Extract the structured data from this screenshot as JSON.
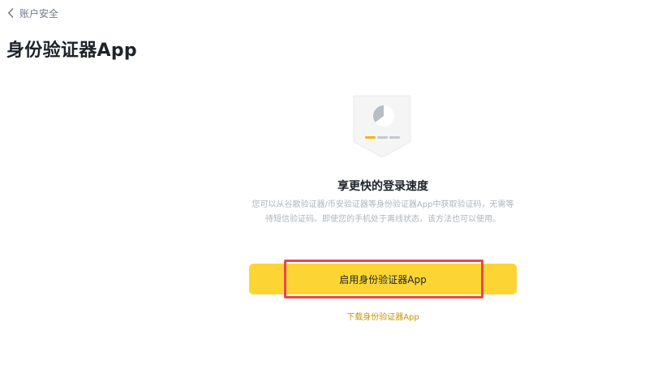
{
  "breadcrumb": {
    "label": "账户安全",
    "icon": "chevron-left-icon"
  },
  "page": {
    "title": "身份验证器App"
  },
  "main": {
    "headline": "享更快的登录速度",
    "description": "您可以从谷歌验证器/币安验证器等身份验证器App中获取验证码，无需等待短信验证码。即使您的手机处于离线状态，该方法也可以使用。",
    "primary_button_label": "启用身份验证器App",
    "download_link_label": "下载身份验证器App",
    "illustration_icon": "authenticator-shield-icon"
  },
  "colors": {
    "accent": "#fcd535",
    "link": "#c99400",
    "highlight": "#e8474f",
    "text_primary": "#1e2329",
    "text_secondary": "#aeb4bc"
  }
}
